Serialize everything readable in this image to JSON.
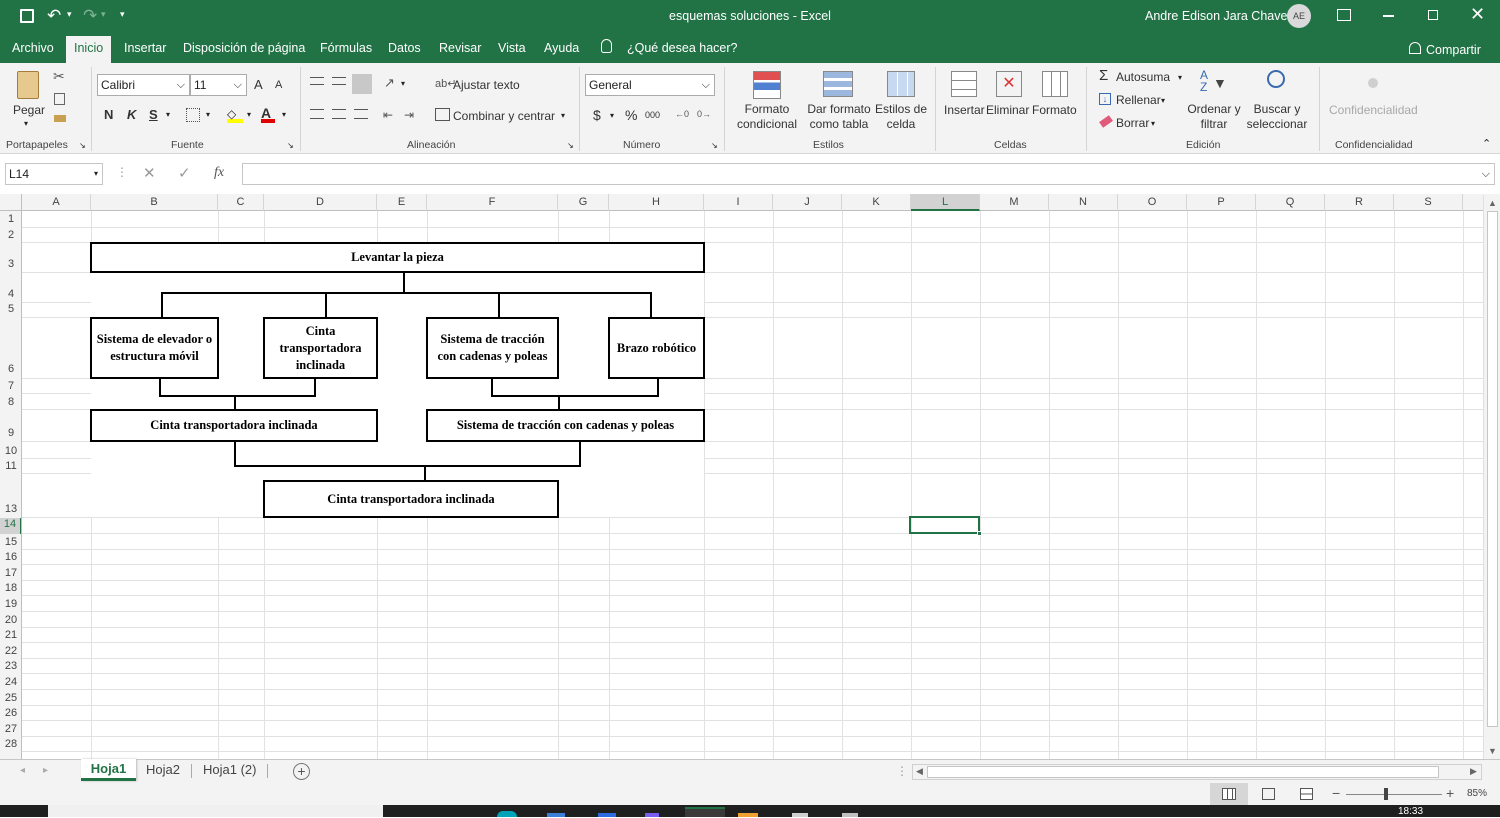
{
  "window": {
    "title": "esquemas soluciones  -  Excel",
    "user_name": "Andre Edison Jara Chavez",
    "user_initials": "AE"
  },
  "tabs": [
    "Archivo",
    "Inicio",
    "Insertar",
    "Disposición de página",
    "Fórmulas",
    "Datos",
    "Revisar",
    "Vista",
    "Ayuda"
  ],
  "active_tab": "Inicio",
  "tell_me": "¿Qué desea hacer?",
  "share_label": "Compartir",
  "ribbon": {
    "clipboard": {
      "paste": "Pegar",
      "group": "Portapapeles"
    },
    "font": {
      "name": "Calibri",
      "size": "11",
      "bold": "N",
      "italic": "K",
      "underline": "S",
      "group": "Fuente",
      "grow": "A",
      "shrink": "A"
    },
    "alignment": {
      "wrap": "Ajustar texto",
      "merge": "Combinar y centrar",
      "group": "Alineación"
    },
    "number": {
      "format": "General",
      "currency": "$",
      "percent": "%",
      "thousands": "000",
      "group": "Número"
    },
    "styles": {
      "conditional_1": "Formato",
      "conditional_2": "condicional",
      "table_1": "Dar formato",
      "table_2": "como tabla",
      "cell_1": "Estilos de",
      "cell_2": "celda",
      "group": "Estilos"
    },
    "cells": {
      "insert": "Insertar",
      "delete": "Eliminar",
      "format": "Formato",
      "group": "Celdas"
    },
    "editing": {
      "autosum": "Autosuma",
      "fill": "Rellenar",
      "clear": "Borrar",
      "sort_1": "Ordenar y",
      "sort_2": "filtrar",
      "find_1": "Buscar y",
      "find_2": "seleccionar",
      "group": "Edición"
    },
    "sensitivity": {
      "label": "Confidencialidad",
      "group": "Confidencialidad"
    }
  },
  "formula_bar": {
    "name_box": "L14",
    "fx": "fx",
    "content": ""
  },
  "columns": [
    "A",
    "B",
    "C",
    "D",
    "E",
    "F",
    "G",
    "H",
    "I",
    "J",
    "K",
    "L",
    "M",
    "N",
    "O",
    "P",
    "Q",
    "R",
    "S"
  ],
  "selected_column": "L",
  "rows": [
    "1",
    "2",
    "3",
    "4",
    "5",
    "6",
    "7",
    "8",
    "9",
    "10",
    "11",
    "13",
    "14",
    "15",
    "16",
    "17",
    "18",
    "19",
    "20",
    "21",
    "22",
    "23",
    "24",
    "25",
    "26",
    "27",
    "28"
  ],
  "selected_row": "14",
  "diagram": {
    "root": "Levantar la pieza",
    "level1": [
      "Sistema de elevador o estructura móvil",
      "Cinta transportadora inclinada",
      "Sistema de tracción con cadenas y poleas",
      "Brazo robótico"
    ],
    "level2": [
      "Cinta transportadora inclinada",
      "Sistema de tracción con cadenas y poleas"
    ],
    "level3": "Cinta transportadora inclinada"
  },
  "sheets": [
    "Hoja1",
    "Hoja2",
    "Hoja1 (2)"
  ],
  "active_sheet": "Hoja1",
  "zoom": "85%",
  "clock": "18:33",
  "colors": {
    "excel_green": "#217346",
    "ribbon_bg": "#f3f3f3",
    "selection": "#217346"
  }
}
